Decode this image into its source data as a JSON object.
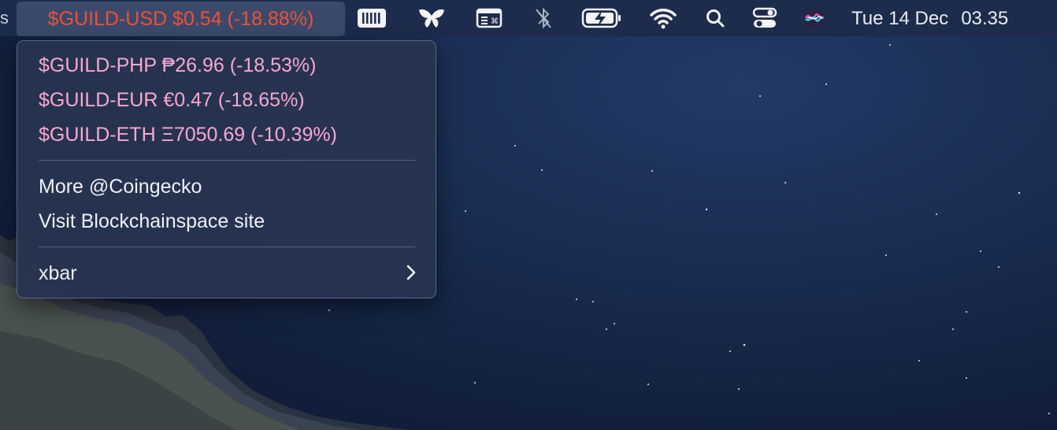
{
  "menubar": {
    "edge_glyph": "s",
    "ticker": "$GUILD-USD $0.54 (-18.88%)",
    "icons": [
      "keyboard-icon",
      "butterfly-icon",
      "shortcut-window-icon",
      "bluetooth-off-icon",
      "battery-charging-icon",
      "wifi-icon",
      "search-icon",
      "control-center-icon",
      "siri-icon"
    ],
    "clock": {
      "date": "Tue 14 Dec",
      "time": "03.35"
    },
    "ticker_color": "#ee5135"
  },
  "dropdown": {
    "prices": [
      {
        "label": "$GUILD-PHP ₱26.96 (-18.53%)"
      },
      {
        "label": "$GUILD-EUR €0.47 (-18.65%)"
      },
      {
        "label": "$GUILD-ETH Ξ7050.69 (-10.39%)"
      }
    ],
    "links": [
      {
        "label": "More @Coingecko"
      },
      {
        "label": "Visit Blockchainspace site"
      }
    ],
    "xbar": {
      "label": "xbar"
    },
    "price_color": "#f7a8d0"
  }
}
